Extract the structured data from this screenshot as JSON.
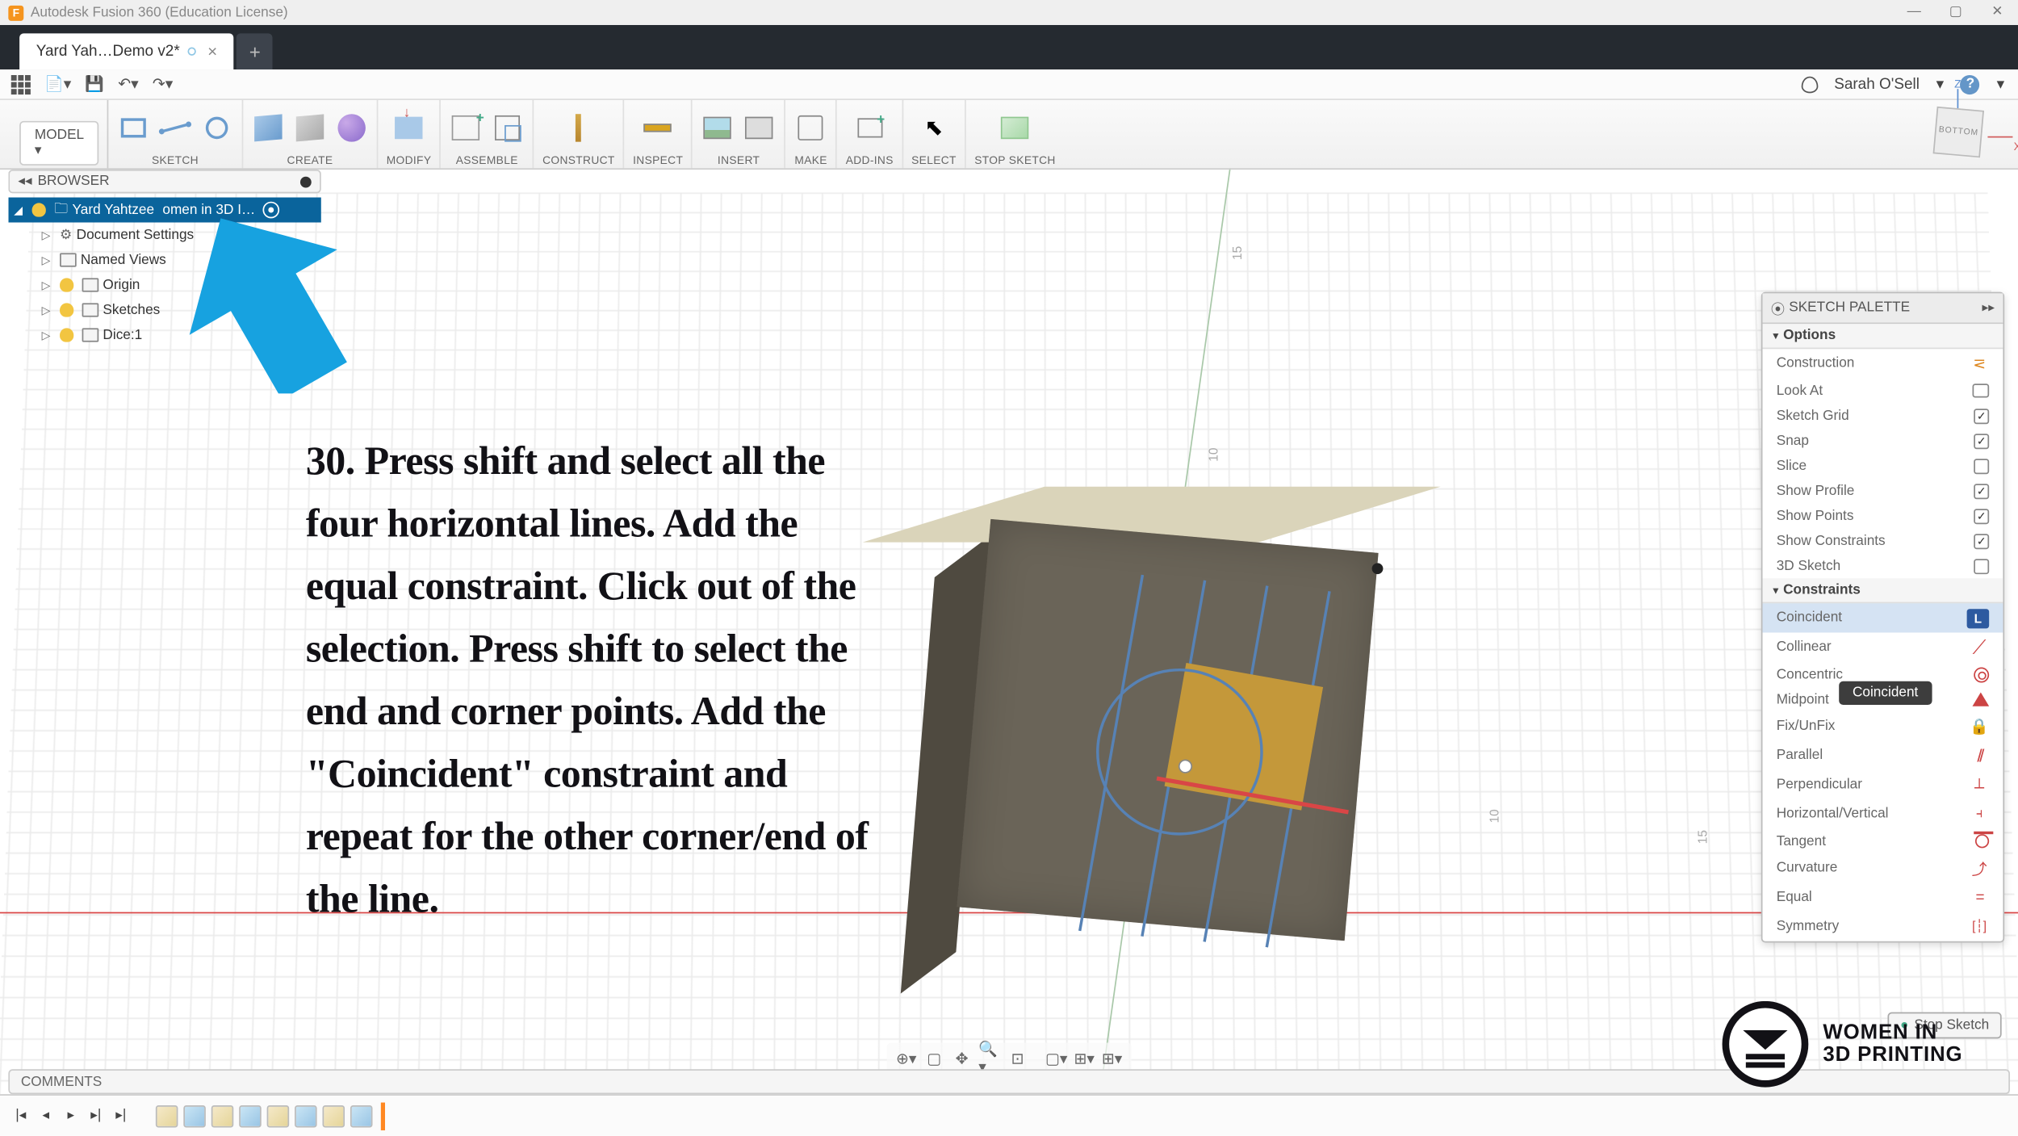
{
  "app": {
    "title": "Autodesk Fusion 360 (Education License)"
  },
  "tabs": {
    "active": "Yard Yah…Demo v2*"
  },
  "user": {
    "name": "Sarah O'Sell"
  },
  "ribbon": {
    "model": "MODEL",
    "sections": [
      "SKETCH",
      "CREATE",
      "MODIFY",
      "ASSEMBLE",
      "CONSTRUCT",
      "INSPECT",
      "INSERT",
      "MAKE",
      "ADD-INS",
      "SELECT",
      "STOP SKETCH"
    ]
  },
  "browser": {
    "title": "BROWSER",
    "root": "Yard Yahtzee",
    "root_suffix": "omen in 3D I…",
    "items": [
      "Document Settings",
      "Named Views",
      "Origin",
      "Sketches",
      "Dice:1"
    ]
  },
  "rulers": {
    "t1": "15",
    "t2": "10",
    "t3": "10",
    "t4": "15"
  },
  "view_cube": {
    "face": "BOTTOM",
    "z": "Z",
    "x": "X"
  },
  "sketch_palette": {
    "title": "SKETCH PALETTE",
    "options_header": "Options",
    "options": [
      {
        "label": "Construction",
        "type": "icon"
      },
      {
        "label": "Look At",
        "type": "icon"
      },
      {
        "label": "Sketch Grid",
        "type": "check",
        "checked": true
      },
      {
        "label": "Snap",
        "type": "check",
        "checked": true
      },
      {
        "label": "Slice",
        "type": "check",
        "checked": false
      },
      {
        "label": "Show Profile",
        "type": "check",
        "checked": true
      },
      {
        "label": "Show Points",
        "type": "check",
        "checked": true
      },
      {
        "label": "Show Constraints",
        "type": "check",
        "checked": true
      },
      {
        "label": "3D Sketch",
        "type": "check",
        "checked": false
      }
    ],
    "constraints_header": "Constraints",
    "constraints": [
      "Coincident",
      "Collinear",
      "Concentric",
      "Midpoint",
      "Fix/UnFix",
      "Parallel",
      "Perpendicular",
      "Horizontal/Vertical",
      "Tangent",
      "Curvature",
      "Equal",
      "Symmetry"
    ]
  },
  "tooltip": "Coincident",
  "stop_sketch_btn": "Stop Sketch",
  "comments": "COMMENTS",
  "instruction": "30. Press shift and select all the four horizontal lines. Add the equal constraint. Click out of the selection. Press shift to select the end and corner points. Add the \"Coincident\" constraint and repeat for the other corner/end of the line.",
  "logo": {
    "line1": "WOMEN IN",
    "line2": "3D PRINTING"
  }
}
